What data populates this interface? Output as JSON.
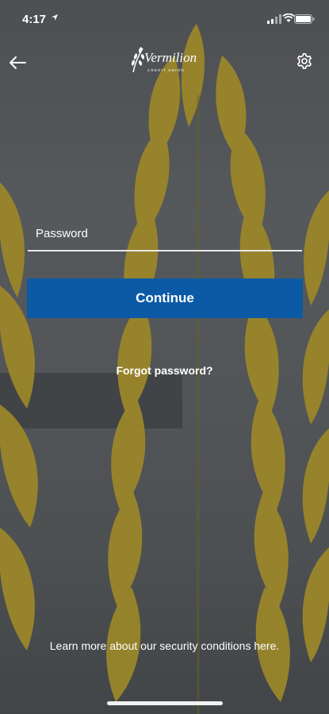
{
  "status_bar": {
    "time": "4:17"
  },
  "header": {
    "logo_text": "Vermilion",
    "logo_subtext": "CREDIT UNION"
  },
  "form": {
    "password_label": "Password",
    "continue_label": "Continue",
    "forgot_label": "Forgot password?"
  },
  "footer": {
    "security_text": "Learn more about our security conditions here."
  },
  "colors": {
    "primary": "#0c5aa6",
    "wheat": "#b49a2a"
  }
}
